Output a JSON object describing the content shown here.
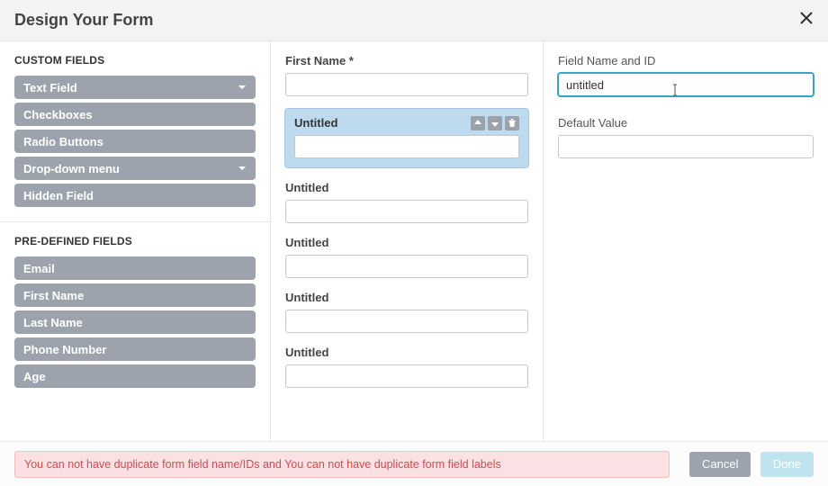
{
  "header": {
    "title": "Design Your Form"
  },
  "sidebar": {
    "custom_label": "CUSTOM FIELDS",
    "custom_fields": [
      {
        "label": "Text Field",
        "has_dropdown": true
      },
      {
        "label": "Checkboxes",
        "has_dropdown": false
      },
      {
        "label": "Radio Buttons",
        "has_dropdown": false
      },
      {
        "label": "Drop-down menu",
        "has_dropdown": true
      },
      {
        "label": "Hidden Field",
        "has_dropdown": false
      }
    ],
    "predefined_label": "PRE-DEFINED FIELDS",
    "predefined_fields": [
      {
        "label": "Email"
      },
      {
        "label": "First Name"
      },
      {
        "label": "Last Name"
      },
      {
        "label": "Phone Number"
      },
      {
        "label": "Age"
      }
    ]
  },
  "canvas": {
    "fields": [
      {
        "label": "First Name *",
        "selected": false
      },
      {
        "label": "Untitled",
        "selected": true
      },
      {
        "label": "Untitled",
        "selected": false
      },
      {
        "label": "Untitled",
        "selected": false
      },
      {
        "label": "Untitled",
        "selected": false
      },
      {
        "label": "Untitled",
        "selected": false
      }
    ]
  },
  "properties": {
    "name_label": "Field Name and ID",
    "name_value": "untitled",
    "default_label": "Default Value",
    "default_value": ""
  },
  "footer": {
    "error": "You can not have duplicate form field name/IDs and You can not have duplicate form field labels",
    "cancel": "Cancel",
    "done": "Done"
  }
}
